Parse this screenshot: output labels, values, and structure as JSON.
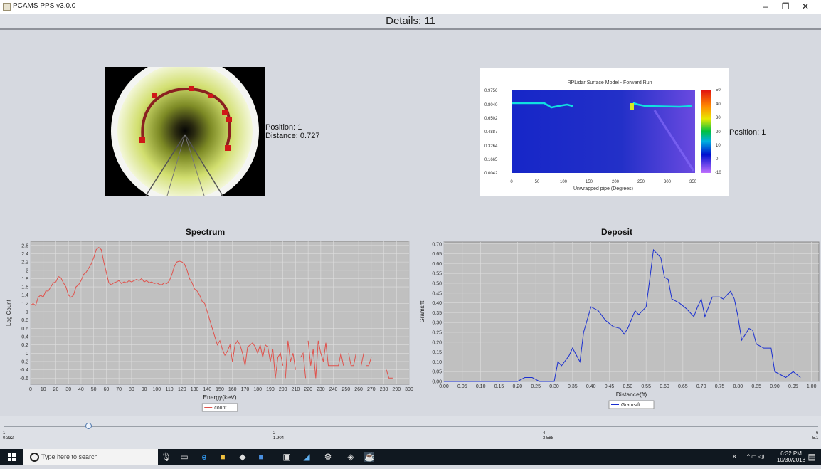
{
  "window": {
    "title": "PCAMS PPS v3.0.0",
    "minimize_icon": "minimize-icon",
    "maximize_icon": "restore-icon",
    "close_icon": "close-icon"
  },
  "header": {
    "title": "Details: 11"
  },
  "camera": {
    "position_label": "Position: 1",
    "distance_label": "Distance: 0.727"
  },
  "lidar": {
    "title": "RPLidar Surface Model - Forward Run",
    "xlabel": "Unwrapped pipe (Degrees)",
    "y_ticks": [
      "0.9756",
      "0.8040",
      "0.6502",
      "0.4887",
      "0.3264",
      "0.1665",
      "0.0042"
    ],
    "x_ticks": [
      "0",
      "50",
      "100",
      "150",
      "200",
      "250",
      "300",
      "350"
    ],
    "colorbar_ticks": [
      "50",
      "40",
      "30",
      "20",
      "10",
      "0",
      "-10"
    ],
    "position_label": "Position: 1"
  },
  "chart_data": [
    {
      "type": "line",
      "title": "Spectrum",
      "xlabel": "Energy(keV)",
      "ylabel": "Log Count",
      "xlim": [
        0,
        300
      ],
      "ylim": [
        -0.75,
        2.7
      ],
      "x_ticks": [
        0,
        10,
        20,
        30,
        40,
        50,
        60,
        70,
        80,
        90,
        100,
        110,
        120,
        130,
        140,
        150,
        160,
        170,
        180,
        190,
        200,
        210,
        220,
        230,
        240,
        250,
        260,
        270,
        280,
        290,
        300
      ],
      "y_ticks": [
        2.6,
        2.4,
        2.2,
        2.0,
        1.8,
        1.6,
        1.4,
        1.2,
        1.0,
        0.8,
        0.6,
        0.4,
        0.2,
        0.0,
        -0.2,
        -0.4,
        -0.6
      ],
      "grid": true,
      "legend": "bottom",
      "color": "#e0524c",
      "series": [
        {
          "name": "count",
          "segments": [
            [
              [
                0,
                1.15
              ],
              [
                2,
                1.2
              ],
              [
                4,
                1.15
              ],
              [
                6,
                1.35
              ],
              [
                8,
                1.4
              ],
              [
                10,
                1.35
              ],
              [
                12,
                1.5
              ],
              [
                14,
                1.5
              ],
              [
                16,
                1.6
              ],
              [
                18,
                1.7
              ],
              [
                20,
                1.72
              ],
              [
                22,
                1.85
              ],
              [
                24,
                1.82
              ],
              [
                26,
                1.7
              ],
              [
                28,
                1.6
              ],
              [
                30,
                1.4
              ],
              [
                32,
                1.35
              ],
              [
                34,
                1.4
              ],
              [
                36,
                1.6
              ],
              [
                38,
                1.65
              ],
              [
                40,
                1.75
              ],
              [
                42,
                1.9
              ],
              [
                44,
                1.95
              ],
              [
                46,
                2.05
              ],
              [
                48,
                2.15
              ],
              [
                50,
                2.3
              ],
              [
                52,
                2.5
              ],
              [
                54,
                2.55
              ],
              [
                56,
                2.5
              ],
              [
                58,
                2.2
              ],
              [
                60,
                1.95
              ],
              [
                62,
                1.7
              ],
              [
                64,
                1.65
              ],
              [
                66,
                1.7
              ],
              [
                68,
                1.72
              ],
              [
                70,
                1.75
              ],
              [
                72,
                1.68
              ],
              [
                74,
                1.72
              ],
              [
                76,
                1.7
              ],
              [
                78,
                1.75
              ],
              [
                80,
                1.72
              ],
              [
                82,
                1.75
              ],
              [
                84,
                1.78
              ],
              [
                86,
                1.75
              ],
              [
                88,
                1.8
              ],
              [
                90,
                1.72
              ],
              [
                92,
                1.75
              ],
              [
                94,
                1.7
              ],
              [
                96,
                1.72
              ],
              [
                98,
                1.68
              ],
              [
                100,
                1.7
              ],
              [
                102,
                1.66
              ],
              [
                104,
                1.65
              ],
              [
                106,
                1.7
              ],
              [
                108,
                1.68
              ],
              [
                110,
                1.75
              ],
              [
                112,
                1.9
              ],
              [
                114,
                2.1
              ],
              [
                116,
                2.2
              ],
              [
                118,
                2.22
              ],
              [
                120,
                2.2
              ],
              [
                122,
                2.15
              ],
              [
                124,
                2.0
              ],
              [
                126,
                1.8
              ],
              [
                128,
                1.7
              ],
              [
                130,
                1.55
              ],
              [
                132,
                1.5
              ],
              [
                134,
                1.4
              ],
              [
                136,
                1.25
              ],
              [
                138,
                1.2
              ],
              [
                140,
                1.0
              ],
              [
                142,
                0.8
              ],
              [
                144,
                0.6
              ],
              [
                146,
                0.4
              ],
              [
                148,
                0.2
              ],
              [
                150,
                0.3
              ],
              [
                152,
                0.1
              ],
              [
                154,
                -0.05
              ],
              [
                156,
                0.05
              ],
              [
                158,
                0.2
              ],
              [
                160,
                -0.2
              ],
              [
                162,
                0.2
              ],
              [
                164,
                0.3
              ],
              [
                166,
                0.2
              ],
              [
                168,
                0.0
              ],
              [
                170,
                -0.3
              ],
              [
                172,
                0.15
              ],
              [
                174,
                0.2
              ],
              [
                176,
                0.25
              ],
              [
                178,
                0.15
              ],
              [
                180,
                0.0
              ],
              [
                182,
                0.2
              ],
              [
                184,
                -0.1
              ],
              [
                186,
                0.2
              ],
              [
                188,
                0.15
              ],
              [
                190,
                -0.2
              ],
              [
                192,
                0.1
              ],
              [
                194,
                -0.6
              ],
              [
                196,
                -0.1
              ],
              [
                198,
                0.0
              ],
              [
                200,
                -0.3
              ]
            ],
            [
              [
                202,
                -0.6
              ],
              [
                204,
                0.3
              ],
              [
                206,
                -0.2
              ],
              [
                208,
                0.0
              ],
              [
                210,
                -0.4
              ]
            ],
            [
              [
                214,
                -0.1
              ],
              [
                216,
                0.0
              ],
              [
                218,
                -0.6
              ]
            ],
            [
              [
                220,
                0.3
              ],
              [
                222,
                -0.3
              ],
              [
                224,
                0.1
              ],
              [
                226,
                -0.6
              ],
              [
                228,
                0.3
              ],
              [
                230,
                0.0
              ],
              [
                232,
                -0.2
              ],
              [
                234,
                0.25
              ],
              [
                236,
                -0.3
              ],
              [
                238,
                -0.3
              ],
              [
                240,
                -0.3
              ],
              [
                242,
                -0.3
              ],
              [
                244,
                -0.3
              ],
              [
                246,
                0.0
              ],
              [
                248,
                -0.3
              ]
            ],
            [
              [
                252,
                0.0
              ],
              [
                254,
                -0.3
              ],
              [
                256,
                -0.3
              ],
              [
                258,
                0.0
              ]
            ],
            [
              [
                262,
                -0.3
              ],
              [
                264,
                0.0
              ]
            ],
            [
              [
                266,
                -0.3
              ],
              [
                268,
                -0.3
              ],
              [
                270,
                -0.1
              ]
            ],
            [
              [
                282,
                -0.4
              ],
              [
                284,
                -0.6
              ],
              [
                287,
                -0.6
              ]
            ]
          ]
        }
      ]
    },
    {
      "type": "line",
      "title": "Deposit",
      "xlabel": "Distance(ft)",
      "ylabel": "Grams/ft",
      "xlim": [
        0,
        1.02
      ],
      "ylim": [
        0,
        0.71
      ],
      "x_ticks": [
        "0.00",
        "0.05",
        "0.10",
        "0.15",
        "0.20",
        "0.25",
        "0.30",
        "0.35",
        "0.40",
        "0.45",
        "0.50",
        "0.55",
        "0.60",
        "0.65",
        "0.70",
        "0.75",
        "0.80",
        "0.85",
        "0.90",
        "0.95",
        "1.00"
      ],
      "y_ticks": [
        "0.70",
        "0.65",
        "0.60",
        "0.55",
        "0.50",
        "0.45",
        "0.40",
        "0.35",
        "0.30",
        "0.25",
        "0.20",
        "0.15",
        "0.10",
        "0.05",
        "0.00"
      ],
      "grid": true,
      "legend": "bottom",
      "color": "#1a2fd0",
      "series": [
        {
          "name": "Grams/ft",
          "x": [
            0.0,
            0.05,
            0.1,
            0.15,
            0.2,
            0.22,
            0.24,
            0.26,
            0.28,
            0.29,
            0.3,
            0.31,
            0.32,
            0.34,
            0.35,
            0.37,
            0.38,
            0.4,
            0.42,
            0.44,
            0.46,
            0.48,
            0.49,
            0.5,
            0.52,
            0.53,
            0.55,
            0.56,
            0.57,
            0.58,
            0.59,
            0.6,
            0.61,
            0.62,
            0.64,
            0.66,
            0.68,
            0.69,
            0.7,
            0.71,
            0.72,
            0.73,
            0.74,
            0.75,
            0.76,
            0.77,
            0.78,
            0.79,
            0.8,
            0.81,
            0.82,
            0.83,
            0.84,
            0.85,
            0.86,
            0.87,
            0.89,
            0.9,
            0.91,
            0.93,
            0.95,
            0.97
          ],
          "y": [
            0.0,
            0.0,
            0.0,
            0.0,
            0.0,
            0.02,
            0.02,
            0.0,
            0.0,
            0.0,
            0.0,
            0.1,
            0.08,
            0.13,
            0.17,
            0.1,
            0.25,
            0.38,
            0.36,
            0.31,
            0.28,
            0.27,
            0.24,
            0.27,
            0.36,
            0.34,
            0.38,
            0.52,
            0.67,
            0.65,
            0.63,
            0.53,
            0.52,
            0.42,
            0.4,
            0.37,
            0.33,
            0.38,
            0.42,
            0.33,
            0.38,
            0.43,
            0.43,
            0.43,
            0.42,
            0.44,
            0.46,
            0.42,
            0.33,
            0.21,
            0.24,
            0.27,
            0.26,
            0.19,
            0.18,
            0.17,
            0.17,
            0.05,
            0.04,
            0.02,
            0.05,
            0.02
          ]
        }
      ]
    }
  ],
  "slider": {
    "value": 1,
    "ticks": [
      {
        "label": "1",
        "value": "0.332"
      },
      {
        "label": "2",
        "value": "1.904"
      },
      {
        "label": "4",
        "value": "3.588"
      },
      {
        "label": "6",
        "value": "5.1"
      }
    ]
  },
  "taskbar": {
    "search_placeholder": "Type here to search",
    "time": "6:32 PM",
    "date": "10/30/2018",
    "icons": [
      "microphone-icon",
      "task-view-icon",
      "edge-icon",
      "file-explorer-icon",
      "app-icon",
      "app-icon",
      "terminal-icon",
      "app-icon",
      "settings-icon",
      "app-icon",
      "java-icon"
    ]
  }
}
